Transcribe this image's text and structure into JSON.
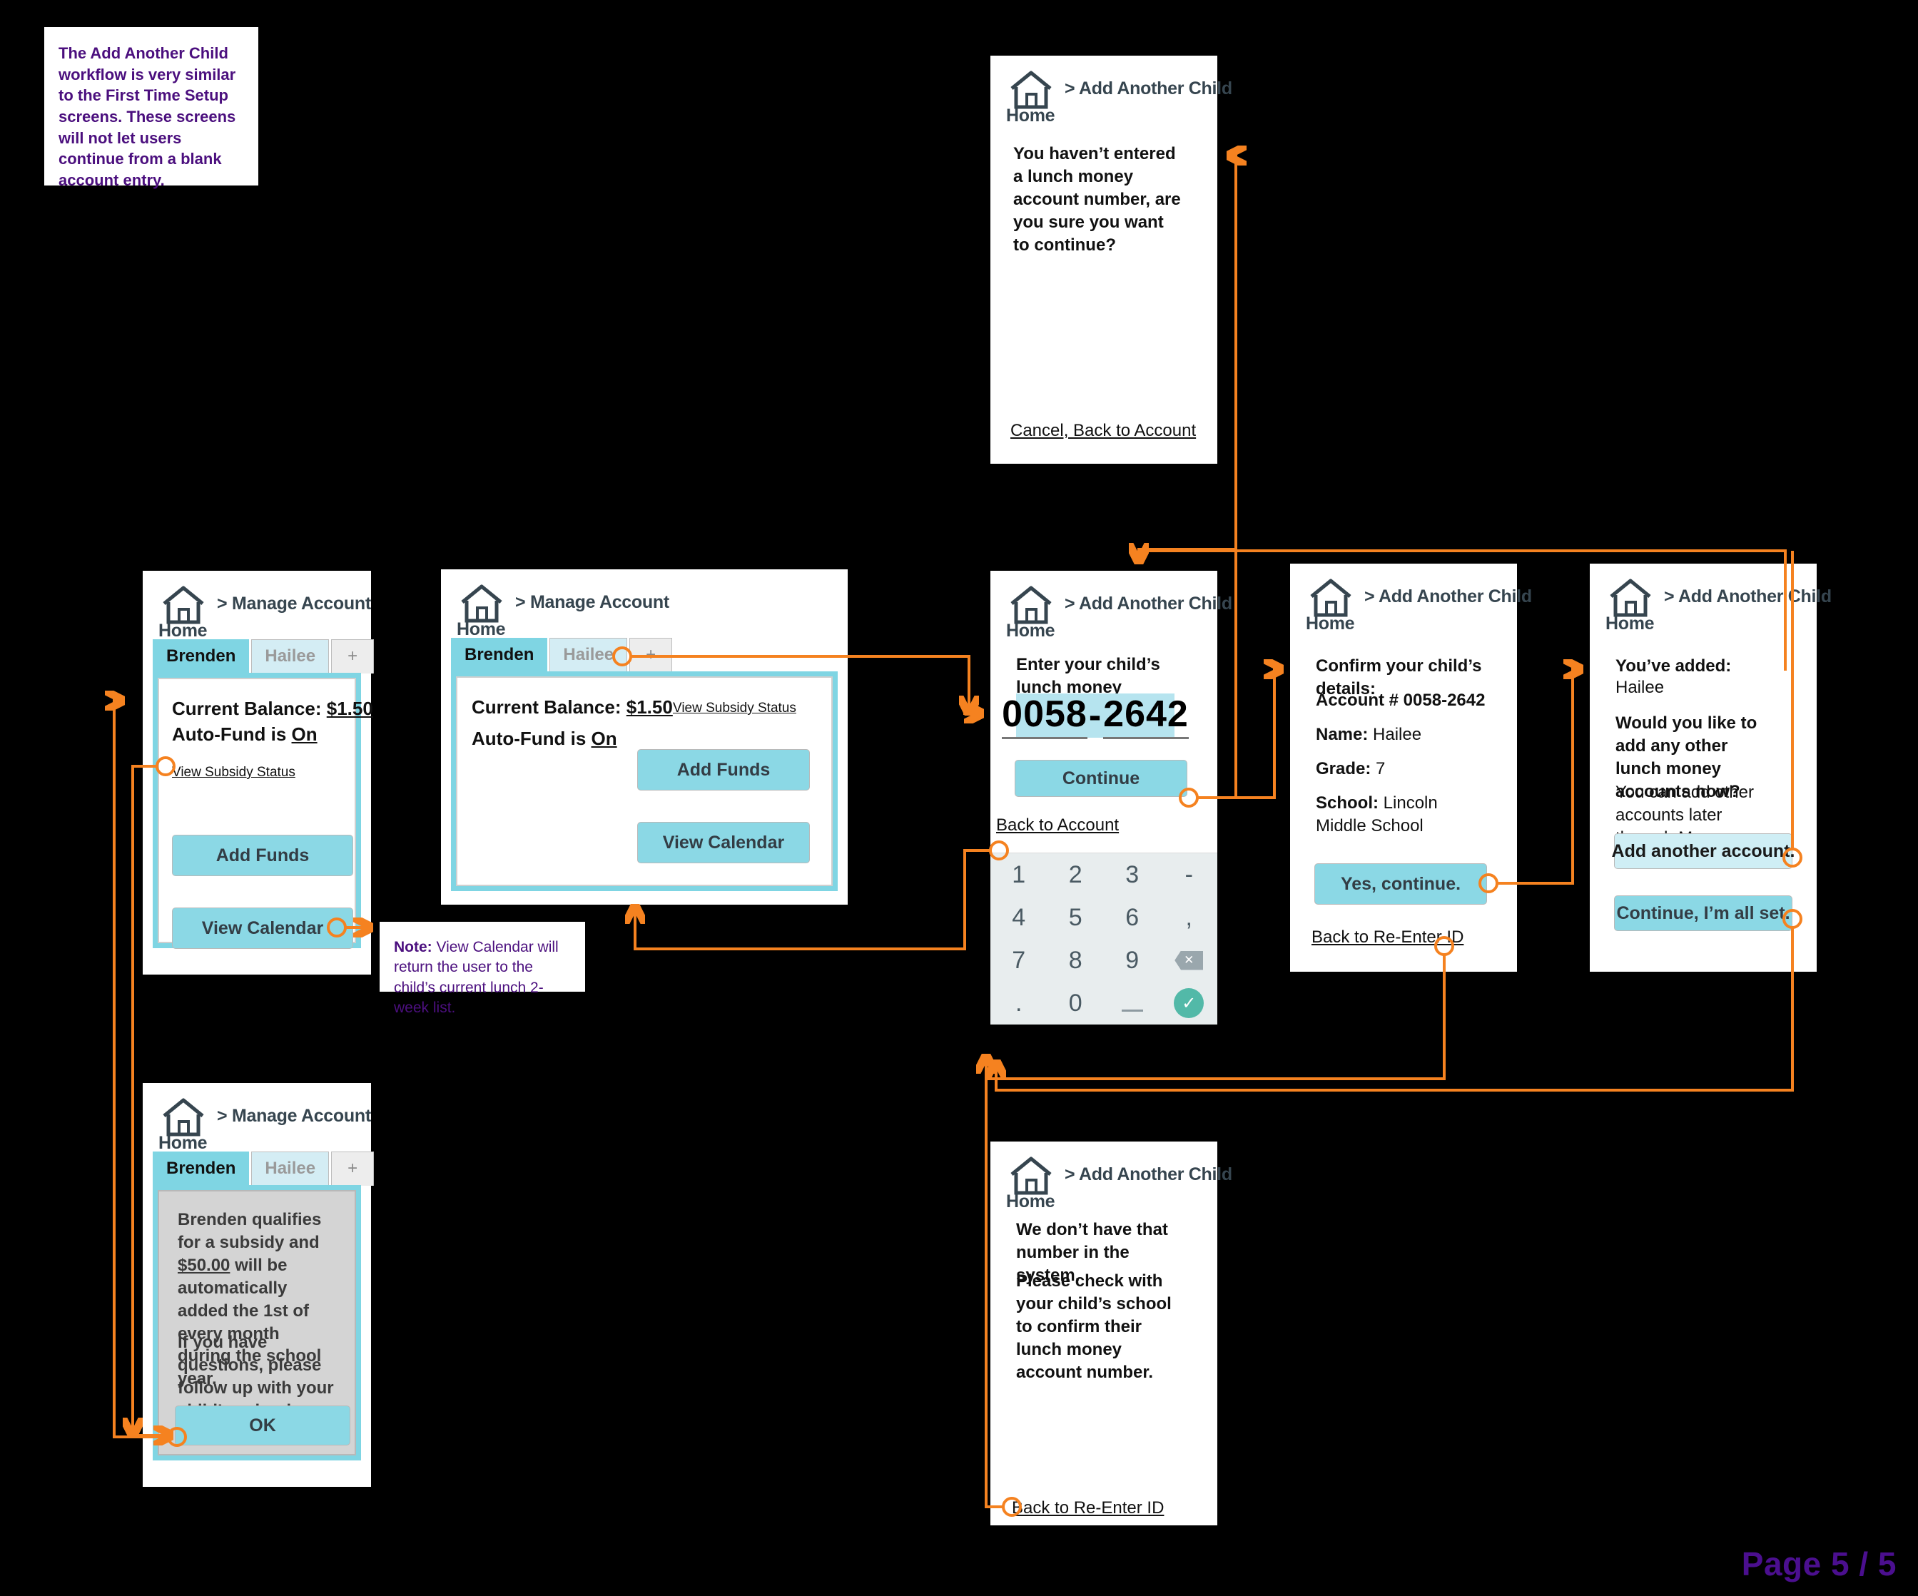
{
  "page": {
    "label": "Page 5 / 5"
  },
  "notes": [
    {
      "id": "intro-note",
      "text": "The Add Another Child workflow is very similar to the First Time Setup screens. These screens will not let users continue from a blank account entry."
    },
    {
      "id": "calendar-note",
      "prefix": "Note:",
      "text": " View Calendar will return the user to the child’s current lunch 2-week list."
    }
  ],
  "screens": {
    "manage_account_1": {
      "home_label": "Home",
      "breadcrumb": "> Manage Account",
      "tabs": [
        {
          "label": "Brenden",
          "state": "active"
        },
        {
          "label": "Hailee",
          "state": "inactive"
        },
        {
          "label": "+",
          "state": "plus"
        }
      ],
      "balance_label": "Current Balance: ",
      "balance_value": "$1.50",
      "autofund_label": "Auto-Fund is ",
      "autofund_value": "On",
      "subsidy_link": "View Subsidy Status",
      "add_funds": "Add Funds",
      "view_calendar": "View Calendar"
    },
    "manage_account_2": {
      "home_label": "Home",
      "breadcrumb": "> Manage Account",
      "tabs": [
        {
          "label": "Brenden",
          "state": "active"
        },
        {
          "label": "Hailee",
          "state": "inactive"
        },
        {
          "label": "+",
          "state": "plus"
        }
      ],
      "balance_label": "Current Balance: ",
      "balance_value": "$1.50",
      "autofund_label": "Auto-Fund is ",
      "autofund_value": "On",
      "subsidy_link": "View Subsidy Status",
      "add_funds": "Add Funds",
      "view_calendar": "View Calendar"
    },
    "subsidy_status": {
      "home_label": "Home",
      "breadcrumb": "> Manage Account",
      "tabs": [
        {
          "label": "Brenden",
          "state": "active"
        },
        {
          "label": "Hailee",
          "state": "inactive"
        },
        {
          "label": "+",
          "state": "plus"
        }
      ],
      "message_1_a": "Brenden qualifies for a subsidy and ",
      "message_1_amount": "$50.00",
      "message_1_b": " will be automatically added the 1st of every month during the school year.",
      "message_2": "If you have questions, please follow up with your child’s school.",
      "ok_button": "OK"
    },
    "blank_entry_warning": {
      "home_label": "Home",
      "breadcrumb": "> Add Another Child",
      "message": "You haven’t entered a lunch money account number, are you sure you want to continue?",
      "cancel_link": "Cancel, Back to Account"
    },
    "enter_account": {
      "home_label": "Home",
      "breadcrumb": "> Add Another Child",
      "prompt": "Enter your child’s lunch money account number:",
      "account_part_1": "0058",
      "account_separator": "-",
      "account_part_2": "2642",
      "continue_button": "Continue",
      "back_link": "Back to Account",
      "keypad": [
        "1",
        "2",
        "3",
        "-",
        "4",
        "5",
        "6",
        ",",
        "7",
        "8",
        "9",
        "backspace-key",
        ".",
        "0",
        "underscore-key",
        "ok-key"
      ]
    },
    "confirm_details": {
      "home_label": "Home",
      "breadcrumb": "> Add Another Child",
      "heading": "Confirm your child’s details:",
      "account_line": "Account # 0058-2642",
      "name_label": "Name:",
      "name_value": " Hailee",
      "grade_label": "Grade:",
      "grade_value": " 7",
      "school_label": "School:",
      "school_value": " Lincoln Middle School",
      "yes_button": "Yes, continue.",
      "back_link": "Back to Re-Enter ID"
    },
    "added_confirmation": {
      "home_label": "Home",
      "breadcrumb": "> Add Another Child",
      "added_label": "You’ve added:",
      "added_name": "Hailee",
      "question": "Would you like to add any other lunch money accounts now?",
      "helper": "You can add other accounts later through Manage Account.",
      "add_another_button": "Add another account.",
      "all_set_button": "Continue, I’m all set."
    },
    "number_not_found": {
      "home_label": "Home",
      "breadcrumb": "> Add Another Child",
      "message_1": "We don’t have that number in the system.",
      "message_2": "Please check with your child’s school to confirm their lunch money account number.",
      "back_link": "Back to Re-Enter ID"
    }
  },
  "colors": {
    "accent_teal": "#8bd8e5",
    "tab_active": "#7fd5e3",
    "connector_orange": "#f58220",
    "note_purple": "#4b0f7e",
    "background": "#000000"
  }
}
